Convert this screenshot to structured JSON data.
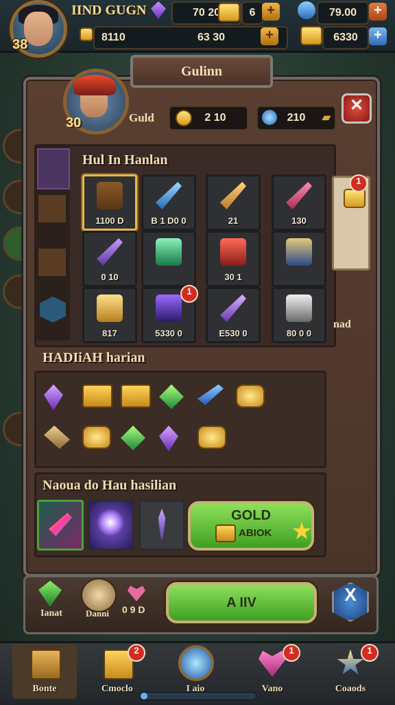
{
  "hud": {
    "level": "38",
    "player_name": "IIND GUGN",
    "gems": "70 20",
    "gems_small": "6",
    "crystals": "79.00",
    "gold": "6330",
    "gold_small": "8110",
    "gold_alt": "63 30"
  },
  "panel": {
    "title": "Gulinn",
    "player_level": "30",
    "guild_label": "Guld",
    "gold": "2 10",
    "crystals": "210"
  },
  "section1": {
    "title": "Hul In Hanlan",
    "items": [
      {
        "value": "1100 D",
        "icon": "treasure-chest-icon",
        "selected": true,
        "badge": ""
      },
      {
        "value": "B 1 D0 0",
        "icon": "blue-sword-icon",
        "selected": false,
        "badge": ""
      },
      {
        "value": "21",
        "icon": "crystal-staff-icon",
        "selected": false,
        "badge": ""
      },
      {
        "value": "130",
        "icon": "pink-blade-icon",
        "selected": false,
        "badge": ""
      },
      {
        "value": "0 10",
        "icon": "magic-wand-icon",
        "selected": false,
        "badge": ""
      },
      {
        "value": "",
        "icon": "emerald-amulet-icon",
        "selected": false,
        "badge": ""
      },
      {
        "value": "30 1",
        "icon": "red-axe-icon",
        "selected": false,
        "badge": ""
      },
      {
        "value": "",
        "icon": "blue-armor-icon",
        "selected": false,
        "badge": ""
      },
      {
        "value": "817",
        "icon": "gold-helmet-icon",
        "selected": false,
        "badge": ""
      },
      {
        "value": "5330 0",
        "icon": "potion-flask-icon",
        "selected": false,
        "badge": "1"
      },
      {
        "value": "E530 0",
        "icon": "crossed-swords-icon",
        "selected": false,
        "badge": ""
      },
      {
        "value": "80 0 0",
        "icon": "scythe-icon",
        "selected": false,
        "badge": ""
      }
    ],
    "side_badge": "1",
    "side_text": "nad"
  },
  "section2": {
    "title": "HADIiAH harian",
    "rewards_row1": [
      "purple-crystal-icon",
      "gift-box-icon",
      "gift-box-icon",
      "green-gem-icon",
      "blue-sword-icon",
      "gold-coins-icon"
    ],
    "rewards_row2": [
      "claw-icon",
      "gold-coins-icon",
      "green-crystal-icon",
      "purple-sword-icon",
      "gold-coins-icon"
    ]
  },
  "section3": {
    "title": "Naoua do Hau hasilian",
    "cards": [
      "rainbow-blade-icon",
      "lightning-orb-icon",
      "dark-spear-icon"
    ],
    "gold_button_title": "GOLD",
    "gold_button_sub": "ABIOK"
  },
  "actionbar": {
    "item1": "Ianat",
    "item2": "Danni",
    "heart_value": "0 9 D",
    "main_button": "A  IIV",
    "close_label": "X"
  },
  "nav": [
    {
      "label": "Bonte",
      "icon": "crate-icon",
      "badge": ""
    },
    {
      "label": "Cmoclo",
      "icon": "gift-box-icon",
      "badge": "2"
    },
    {
      "label": "I aio",
      "icon": "blue-orb-icon",
      "badge": ""
    },
    {
      "label": "Vano",
      "icon": "heart-gem-icon",
      "badge": "1"
    },
    {
      "label": "Coaods",
      "icon": "star-emblem-icon",
      "badge": "1"
    }
  ]
}
